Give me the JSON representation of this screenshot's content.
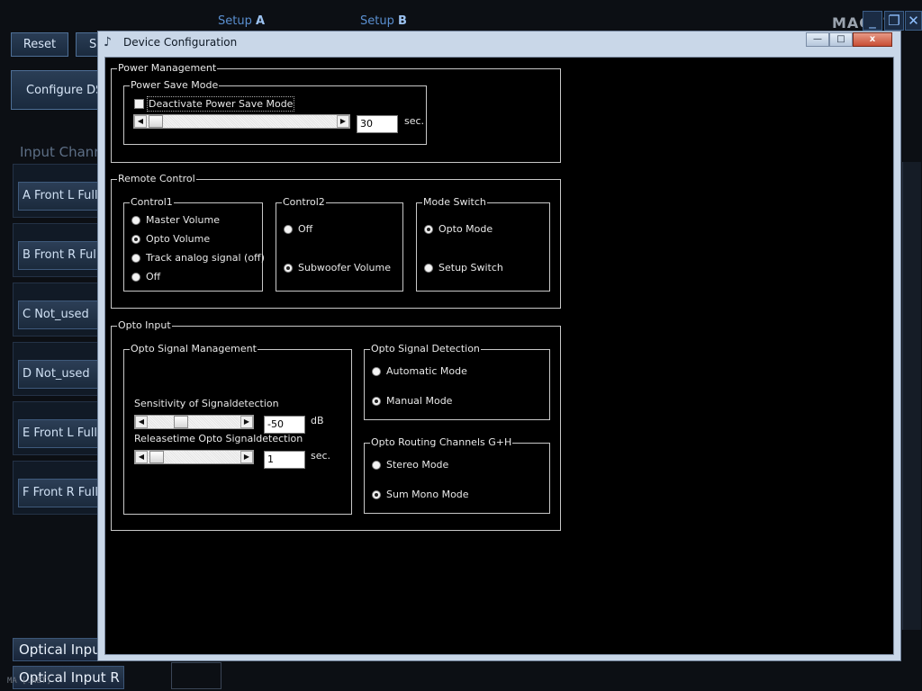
{
  "background_app": {
    "setup_tabs": [
      {
        "prefix": "Setup ",
        "letter": "A"
      },
      {
        "prefix": "Setup ",
        "letter": "B"
      }
    ],
    "buttons": {
      "reset": "Reset",
      "second": "S",
      "configure": "Configure DS"
    },
    "input_channels_label": "Input Chann",
    "channels": [
      {
        "label": "A   Front L Full"
      },
      {
        "label": "B   Front R Full"
      },
      {
        "label": "C    Not_used"
      },
      {
        "label": "D    Not_used"
      },
      {
        "label": "E   Front L Full"
      },
      {
        "label": "F   Front R Full"
      }
    ],
    "optical_inputs": [
      "Optical Input",
      "Optical Input R"
    ],
    "brand": "MACHT",
    "watermark": "MA            [.NET]"
  },
  "dialog": {
    "title": "Device Configuration",
    "window_buttons": {
      "minimize": "—",
      "maximize": "□",
      "close": "x"
    },
    "power_management": {
      "legend": "Power Management",
      "power_save_mode": {
        "legend": "Power Save Mode",
        "checkbox_label": "Deactivate Power Save Mode",
        "checked": false,
        "value": "30",
        "unit": "sec."
      }
    },
    "remote_control": {
      "legend": "Remote Control",
      "control1": {
        "legend": "Control1",
        "options": [
          {
            "label": "Master Volume",
            "selected": false
          },
          {
            "label": "Opto Volume",
            "selected": true
          },
          {
            "label": "Track analog signal (off)",
            "selected": false
          },
          {
            "label": "Off",
            "selected": false
          }
        ]
      },
      "control2": {
        "legend": "Control2",
        "options": [
          {
            "label": "Off",
            "selected": false
          },
          {
            "label": "Subwoofer Volume",
            "selected": true
          }
        ]
      },
      "mode_switch": {
        "legend": "Mode Switch",
        "options": [
          {
            "label": "Opto Mode",
            "selected": true
          },
          {
            "label": "Setup Switch",
            "selected": false
          }
        ]
      }
    },
    "opto_input": {
      "legend": "Opto Input",
      "signal_management": {
        "legend": "Opto Signal Management",
        "sensitivity_label": "Sensitivity of Signaldetection",
        "sensitivity_value": "-50",
        "sensitivity_unit": "dB",
        "release_label": "Releasetime Opto Signaldetection",
        "release_value": "1",
        "release_unit": "sec."
      },
      "signal_detection": {
        "legend": "Opto Signal Detection",
        "options": [
          {
            "label": "Automatic Mode",
            "selected": false
          },
          {
            "label": "Manual Mode",
            "selected": true
          }
        ]
      },
      "routing": {
        "legend": "Opto Routing Channels G+H",
        "options": [
          {
            "label": "Stereo Mode",
            "selected": false
          },
          {
            "label": "Sum Mono Mode",
            "selected": true
          }
        ]
      }
    }
  }
}
